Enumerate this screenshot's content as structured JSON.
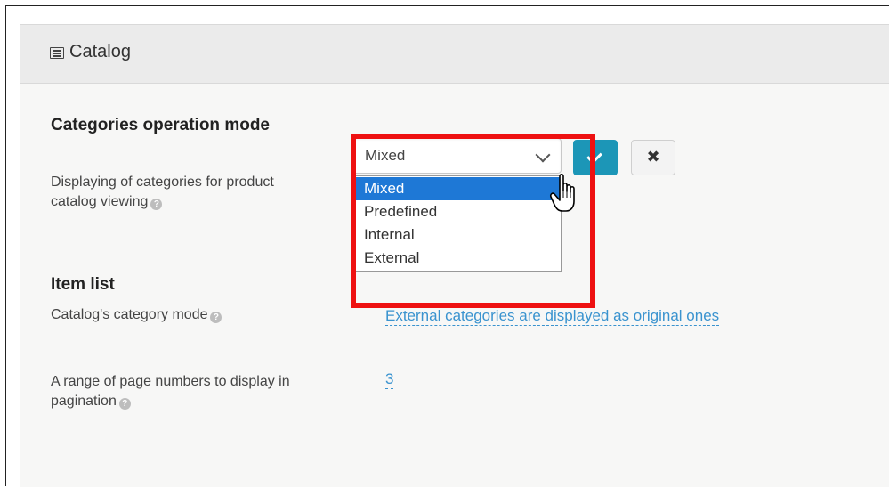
{
  "panel": {
    "title": "Catalog",
    "icon": "list-icon"
  },
  "sections": {
    "categories_mode": {
      "title": "Categories operation mode",
      "field_label_line1": "Displaying of categories for product",
      "field_label_line2": "catalog viewing",
      "select_value": "Mixed",
      "options": [
        "Mixed",
        "Predefined",
        "Internal",
        "External"
      ],
      "selected_option": "Mixed",
      "save_icon": "check-icon",
      "cancel_icon": "close-icon"
    },
    "item_list": {
      "title": "Item list",
      "category_mode_label": "Catalog's category mode",
      "category_mode_value": "External categories are displayed as original ones",
      "pagination_label_line1": "A range of page numbers to display in",
      "pagination_label_line2": "pagination",
      "pagination_value": "3"
    }
  },
  "colors": {
    "accent": "#1c96b7",
    "link": "#3a93cf",
    "highlight": "#ee1111",
    "selected_option": "#1e78d6"
  }
}
